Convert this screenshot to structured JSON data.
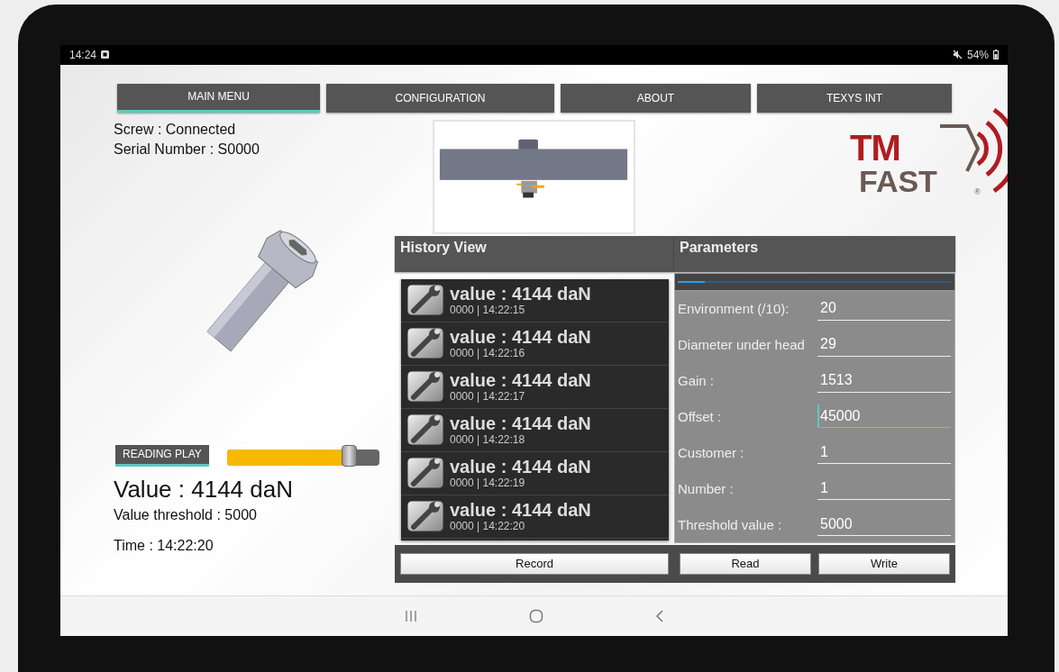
{
  "status_bar": {
    "time": "14:24",
    "battery": "54%"
  },
  "tabs": [
    {
      "label": "MAIN MENU",
      "selected": true
    },
    {
      "label": "CONFIGURATION",
      "selected": false
    },
    {
      "label": "ABOUT",
      "selected": false
    },
    {
      "label": "TEXYS INT",
      "selected": false
    }
  ],
  "screw_status": "Screw : Connected",
  "serial_number": "Serial Number : S0000",
  "logo": {
    "line_1": "TM",
    "line_2": "FAST",
    "mark": "®"
  },
  "reading": {
    "button": "READING PLAY",
    "level": 0.8,
    "value": "Value : 4144 daN",
    "threshold": "Value threshold : 5000",
    "time": "Time : 14:22:20"
  },
  "history": {
    "title": "History View",
    "button": "Record",
    "items": [
      {
        "value": "value : 4144 daN",
        "meta": "0000 | 14:22:15"
      },
      {
        "value": "value : 4144 daN",
        "meta": "0000 | 14:22:16"
      },
      {
        "value": "value : 4144 daN",
        "meta": "0000 | 14:22:17"
      },
      {
        "value": "value : 4144 daN",
        "meta": "0000 | 14:22:18"
      },
      {
        "value": "value : 4144 daN",
        "meta": "0000 | 14:22:19"
      },
      {
        "value": "value : 4144 daN",
        "meta": "0000 | 14:22:20"
      }
    ]
  },
  "parameters": {
    "title": "Parameters",
    "level": 0.1,
    "buttons": [
      "Read",
      "Write"
    ],
    "fields": [
      {
        "label": "Environment (/10):",
        "value": "20",
        "focused": false
      },
      {
        "label": "Diameter under head",
        "value": "29",
        "focused": false
      },
      {
        "label": "Gain :",
        "value": "1513",
        "focused": false
      },
      {
        "label": "Offset :",
        "value": "45000",
        "focused": true
      },
      {
        "label": "Customer :",
        "value": "1",
        "focused": false
      },
      {
        "label": "Number :",
        "value": "1",
        "focused": false
      },
      {
        "label": "Threshold value :",
        "value": "5000",
        "focused": false
      }
    ]
  }
}
